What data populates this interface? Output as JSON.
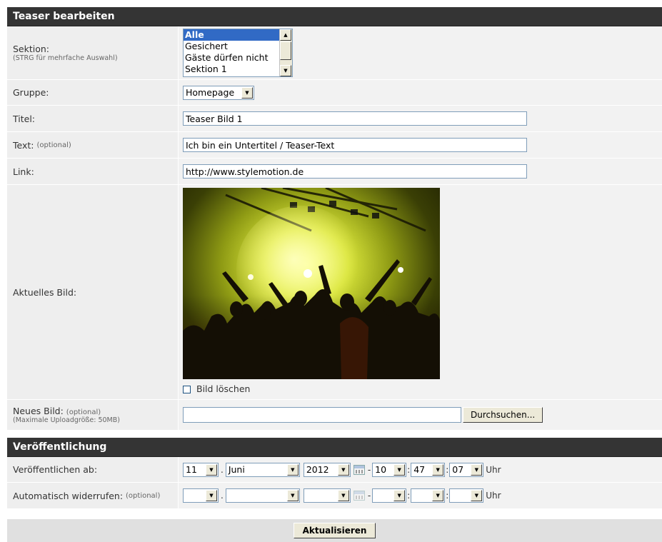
{
  "edit_section": {
    "title": "Teaser bearbeiten",
    "sektion": {
      "label": "Sektion:",
      "hint": "(STRG für mehrfache Auswahl)",
      "options": [
        "Alle",
        "Gesichert",
        "Gäste dürfen nicht",
        "Sektion 1"
      ],
      "selected": "Alle"
    },
    "gruppe": {
      "label": "Gruppe:",
      "value": "Homepage"
    },
    "titel": {
      "label": "Titel:",
      "value": "Teaser Bild 1"
    },
    "text": {
      "label": "Text:",
      "optional": "(optional)",
      "value": "Ich bin ein Untertitel / Teaser-Text"
    },
    "link": {
      "label": "Link:",
      "value": "http://www.stylemotion.de"
    },
    "aktuelles_bild": {
      "label": "Aktuelles Bild:",
      "delete_label": "Bild löschen"
    },
    "neues_bild": {
      "label": "Neues Bild:",
      "optional": "(optional)",
      "hint": "(Maximale Uploadgröße: 50MB)",
      "value": "",
      "browse_label": "Durchsuchen..."
    }
  },
  "publish_section": {
    "title": "Veröffentlichung",
    "publish_from": {
      "label": "Veröffentlichen ab:",
      "day": "11",
      "month": "Juni",
      "year": "2012",
      "hour": "10",
      "minute": "47",
      "second": "07",
      "dot1": ".",
      "dash": "-",
      "colon": ":",
      "uhr": "Uhr"
    },
    "auto_revoke": {
      "label": "Automatisch widerrufen:",
      "optional": "(optional)",
      "day": "",
      "month": "",
      "year": "",
      "hour": "",
      "minute": "",
      "second": "",
      "dot1": ".",
      "dash": "-",
      "colon": ":",
      "uhr": "Uhr"
    }
  },
  "footer": {
    "submit_label": "Aktualisieren"
  }
}
